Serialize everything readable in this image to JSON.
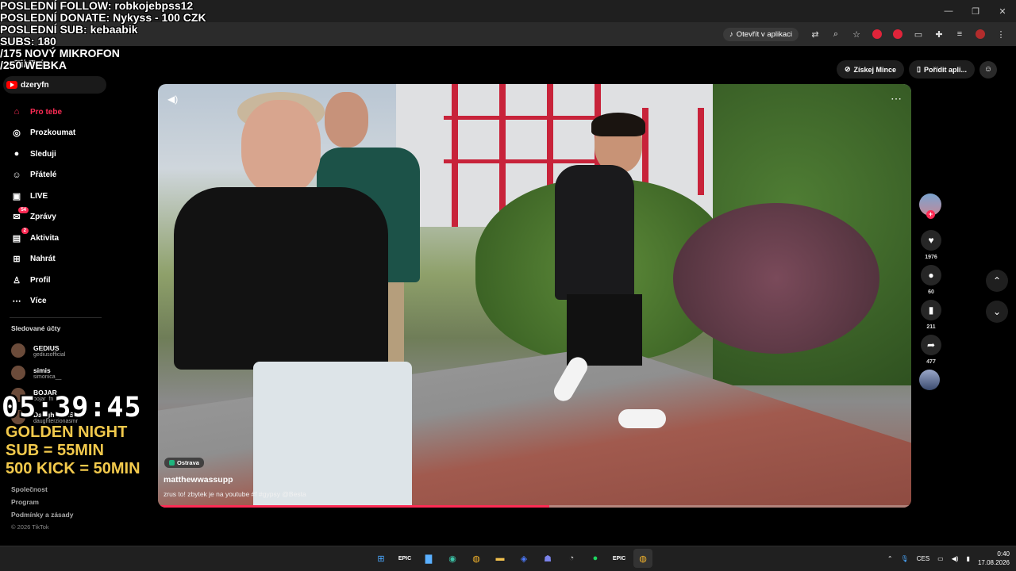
{
  "browser": {
    "open_in_app": "Otevřít v aplikaci"
  },
  "topbar": {
    "coins": "Získej Mince",
    "get_app": "Pořídit apli..."
  },
  "overlay": {
    "lines": [
      "POSLEDNÍ FOLLOW: robkojebpss12",
      " POSLEDNÍ DONATE: Nykyss - 100 CZK",
      "POSLEDNÍ SUB: kebaabik",
      "SUBS: 180",
      " /175 NOVÝ MIKROFON",
      " /250 WEBKA"
    ],
    "timer": "05:39:45",
    "promo": [
      "GOLDEN NIGHT",
      "SUB = 55MIN",
      "500 KICK = 50MIN"
    ]
  },
  "sidebar": {
    "logo": "TikTok",
    "youtube_user": "dzeryfn",
    "items": [
      {
        "label": "Pro tebe",
        "icon": "home-icon",
        "glyph": "⌂"
      },
      {
        "label": "Prozkoumat",
        "icon": "compass-icon",
        "glyph": "◎"
      },
      {
        "label": "Sleduji",
        "icon": "following-icon",
        "glyph": "●"
      },
      {
        "label": "Přátelé",
        "icon": "friends-icon",
        "glyph": "☺"
      },
      {
        "label": "LIVE",
        "icon": "live-icon",
        "glyph": "▣"
      },
      {
        "label": "Zprávy",
        "icon": "messages-icon",
        "glyph": "✉",
        "badge": "54"
      },
      {
        "label": "Aktivita",
        "icon": "activity-icon",
        "glyph": "▤",
        "badge": "2"
      },
      {
        "label": "Nahrát",
        "icon": "upload-icon",
        "glyph": "⊞"
      },
      {
        "label": "Profil",
        "icon": "profile-icon",
        "glyph": "♙"
      },
      {
        "label": "Více",
        "icon": "more-icon",
        "glyph": "⋯"
      }
    ],
    "followed_title": "Sledované účty",
    "followed": [
      {
        "name": "GEDIUS",
        "handle": "gediusofficial"
      },
      {
        "name": "simis",
        "handle": "simonica__"
      },
      {
        "name": "BOJAR_",
        "handle": "bojar_fn"
      },
      {
        "name": "Daughter ASMR",
        "handle": "daughterzionasmr"
      }
    ],
    "footer": [
      "Společnost",
      "Program",
      "Podmínky a zásady"
    ],
    "copyright": "© 2026 TikTok"
  },
  "video": {
    "location": "Ostrava",
    "author": "matthewwassupp",
    "caption": "zrus to! zbytek je na youtube #f #gypsy @Besta",
    "progress": 0.52
  },
  "actions": {
    "likes": "1976",
    "comments": "60",
    "saves": "211",
    "shares": "477"
  },
  "taskbar": {
    "lang": "CES",
    "time": "0:40",
    "date": "17.08.2026"
  },
  "colors": {
    "accent": "#fe2c55",
    "gold": "#f2c94c"
  }
}
